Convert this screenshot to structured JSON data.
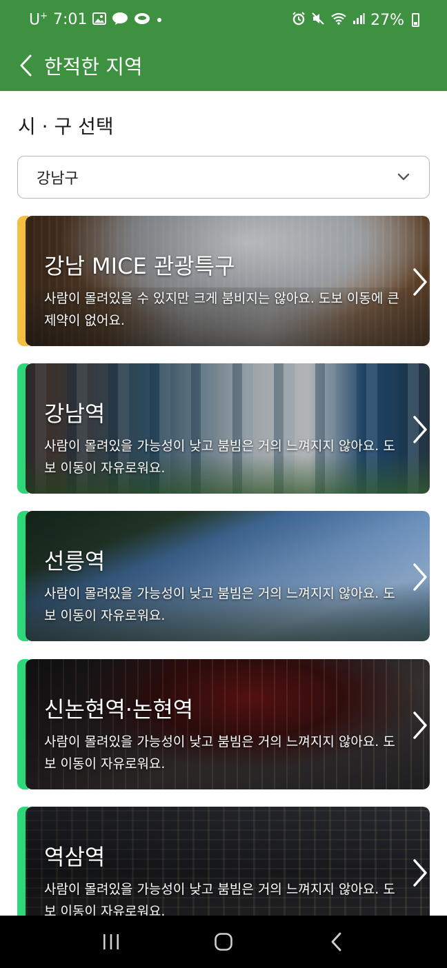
{
  "status_bar": {
    "carrier": "U",
    "carrier_sup": "+",
    "time": "7:01",
    "battery": "27%"
  },
  "app_bar": {
    "title": "한적한 지역"
  },
  "filter": {
    "label": "시 · 구 선택",
    "selected_district": "강남구"
  },
  "areas": [
    {
      "name": "강남 MICE 관광특구",
      "description": "사람이 몰려있을 수 있지만 크게 붐비지는 않아요. 도보 이동에 큰 제약이 없어요.",
      "accent": "#f5c040"
    },
    {
      "name": "강남역",
      "description": "사람이 몰려있을 가능성이 낮고 붐빔은 거의 느껴지지 않아요. 도보 이동이 자유로워요.",
      "accent": "#2ed87a"
    },
    {
      "name": "선릉역",
      "description": "사람이 몰려있을 가능성이 낮고 붐빔은 거의 느껴지지 않아요. 도보 이동이 자유로워요.",
      "accent": "#2ed87a"
    },
    {
      "name": "신논현역·논현역",
      "description": "사람이 몰려있을 가능성이 낮고 붐빔은 거의 느껴지지 않아요. 도보 이동이 자유로워요.",
      "accent": "#2ed87a"
    },
    {
      "name": "역삼역",
      "description": "사람이 몰려있을 가능성이 낮고 붐빔은 거의 느껴지지 않아요. 도보 이동이 자유로워요.",
      "accent": "#2ed87a"
    }
  ],
  "colors": {
    "app_bar": "#3f9142",
    "accent_busy": "#f5c040",
    "accent_calm": "#2ed87a"
  },
  "icons": {
    "back": "chevron-left-icon",
    "dropdown": "chevron-down-icon",
    "card_arrow": "chevron-right-icon",
    "nav_recents": "recents-icon",
    "nav_home": "home-icon",
    "nav_back": "back-icon"
  }
}
